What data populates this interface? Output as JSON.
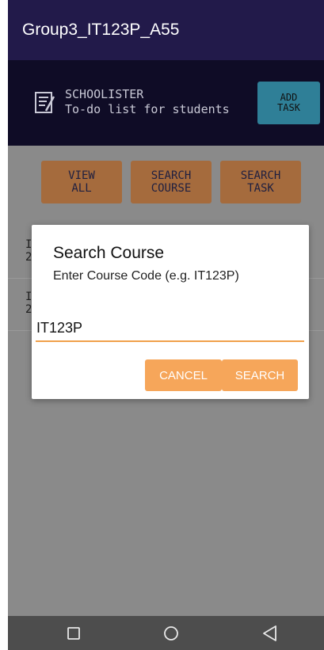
{
  "app": {
    "title": "Group3_IT123P_A55"
  },
  "header": {
    "brand": "SCHOOLISTER",
    "tagline": "To-do list for students",
    "add_task_line1": "ADD",
    "add_task_line2": "TASK",
    "icon": "notepad-icon"
  },
  "nav_buttons": [
    {
      "line1": "VIEW",
      "line2": "ALL"
    },
    {
      "line1": "SEARCH",
      "line2": "COURSE"
    },
    {
      "line1": "SEARCH",
      "line2": "TASK"
    }
  ],
  "list_rows": [
    {
      "line1": "I",
      "line2": "2"
    },
    {
      "line1": "I",
      "line2": "2"
    }
  ],
  "dialog": {
    "title": "Search Course",
    "message": "Enter Course Code (e.g. IT123P)",
    "input_value": "IT123P",
    "cancel_label": "CANCEL",
    "search_label": "SEARCH",
    "accent": "#f0a04b"
  },
  "system_nav": {
    "recent_icon": "square-icon",
    "home_icon": "circle-icon",
    "back_icon": "triangle-back-icon"
  },
  "colors": {
    "title_bar": "#221a4a",
    "header": "#0f0c26",
    "add_task": "#2f7f97",
    "nav_button": "#a56b3d",
    "dialog_button": "#f6a65a",
    "scrim_background": "#8a8a8a",
    "system_nav": "#4d4d4d"
  }
}
